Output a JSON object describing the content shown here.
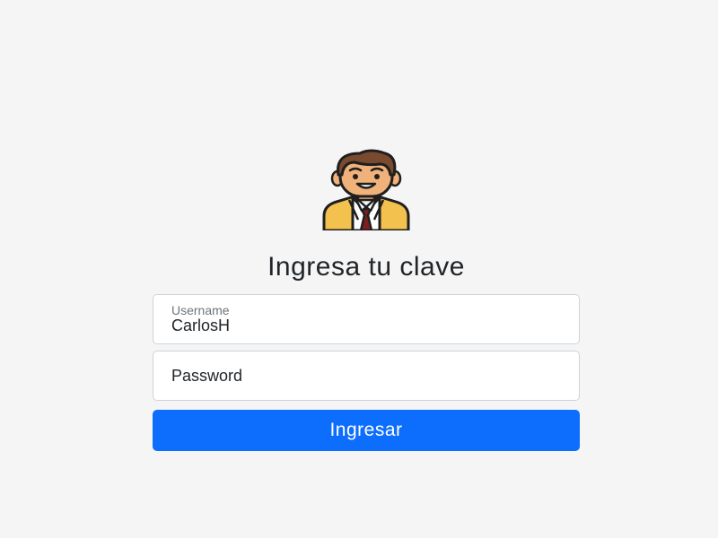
{
  "form": {
    "title": "Ingresa tu clave",
    "username": {
      "label": "Username",
      "value": "CarlosH"
    },
    "password": {
      "placeholder": "Password"
    },
    "submit_label": "Ingresar"
  },
  "avatar": {
    "icon": "businessman-avatar-icon"
  },
  "colors": {
    "background": "#f5f5f5",
    "primary": "#0d6efd",
    "text": "#212529"
  }
}
